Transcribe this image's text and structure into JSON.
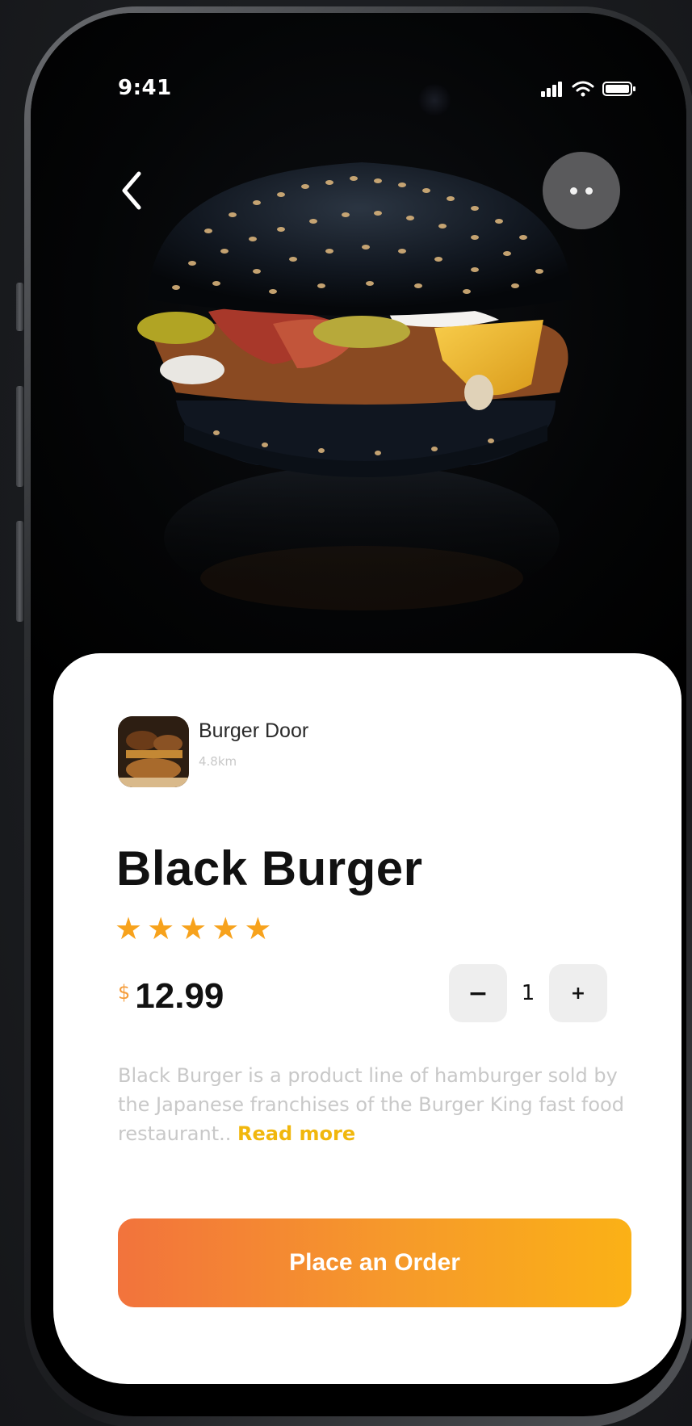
{
  "status_bar": {
    "time": "9:41"
  },
  "shop": {
    "name": "Burger Door",
    "distance": "4.8km"
  },
  "product": {
    "title": "Black Burger",
    "rating": 5,
    "currency": "$",
    "price": "12.99",
    "quantity": "1",
    "description": "Black Burger is a product line of hamburger sold by the Japanese franchises of the Burger King fast food restaurant..",
    "read_more_label": "Read more"
  },
  "stepper": {
    "minus_label": "−",
    "plus_label": "+"
  },
  "actions": {
    "order_label": "Place an Order"
  },
  "icons": {
    "back": "chevron-left-icon",
    "more": "more-dots-icon",
    "signal": "signal-icon",
    "wifi": "wifi-icon",
    "battery": "battery-icon",
    "star": "star-icon"
  },
  "colors": {
    "accent_orange": "#f59c3a",
    "star": "#f7a21c",
    "read_more": "#f1b70d",
    "button_start": "#f2733c",
    "button_end": "#fbb116"
  }
}
